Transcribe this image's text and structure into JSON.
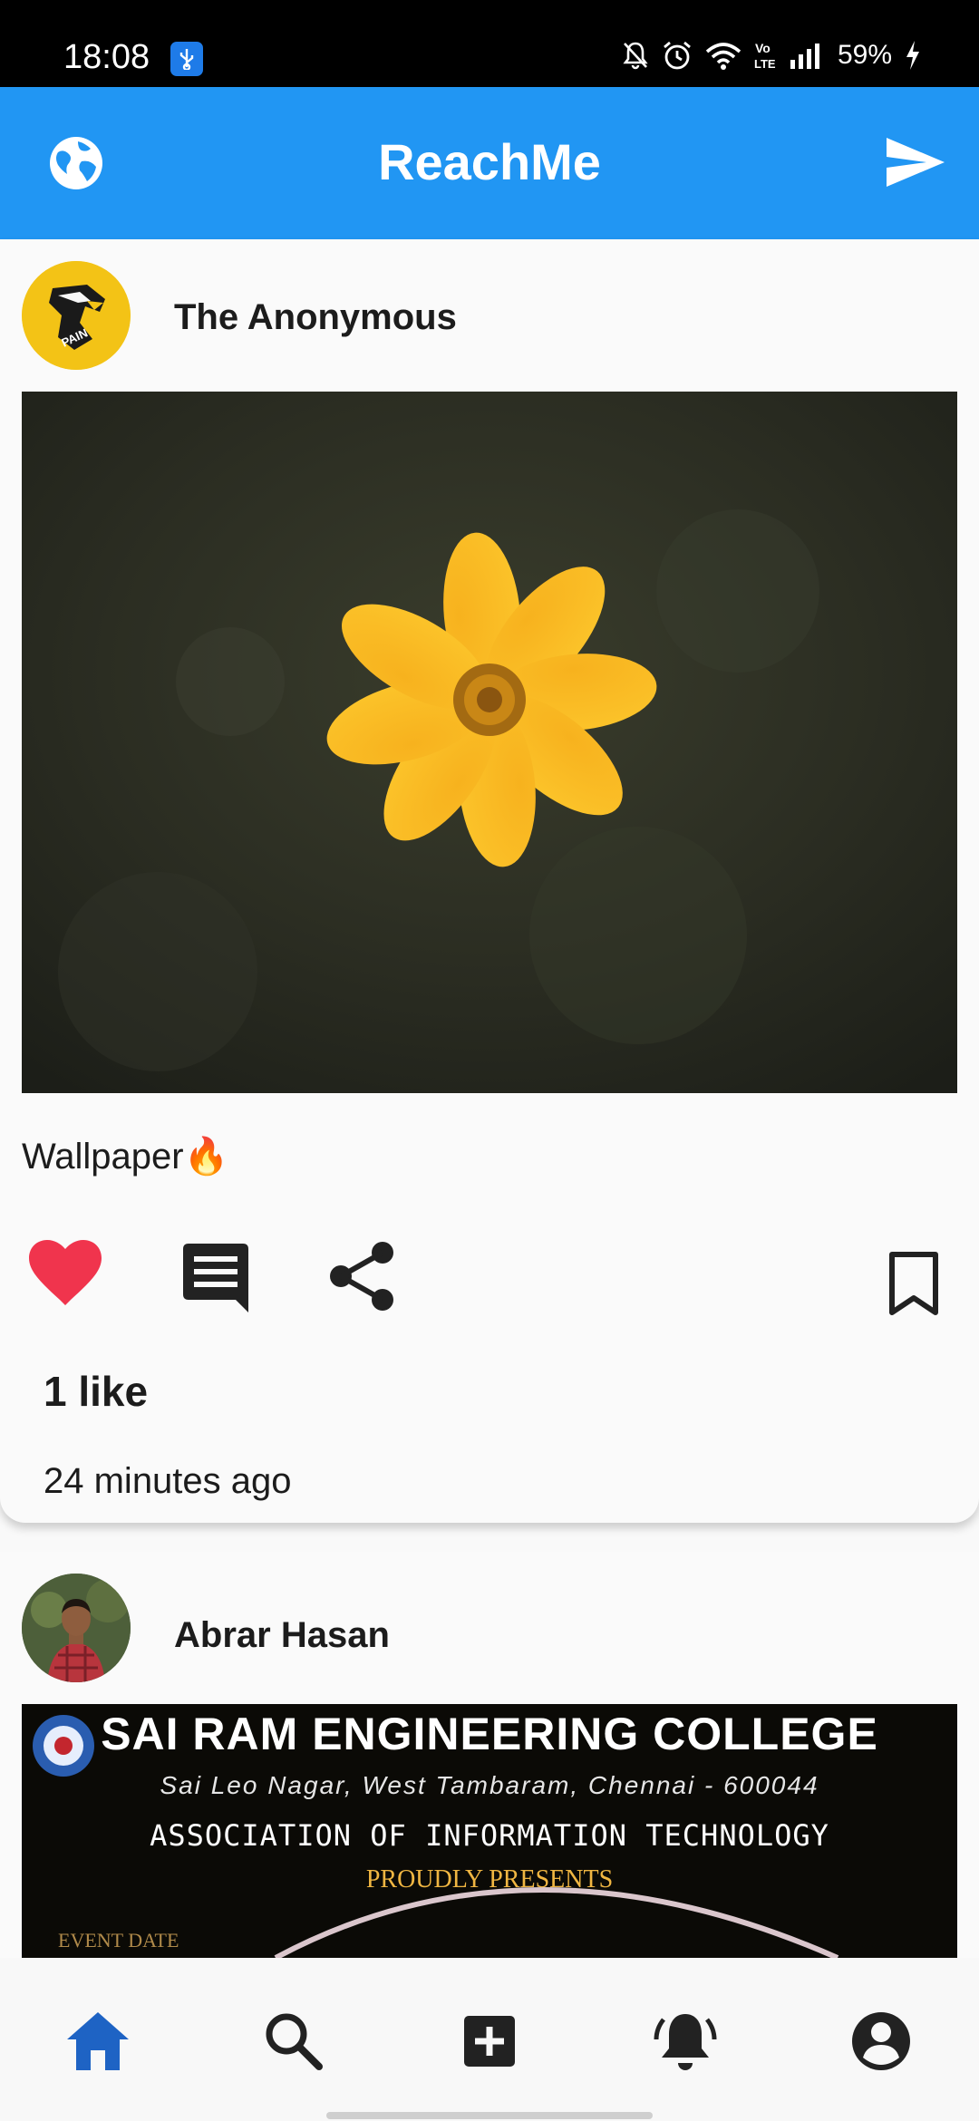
{
  "status_bar": {
    "time": "18:08",
    "battery": "59%",
    "icons": [
      "usb-icon",
      "mute-icon",
      "alarm-icon",
      "wifi-icon",
      "volte-icon",
      "signal-icon",
      "charging-icon"
    ]
  },
  "app_bar": {
    "title": "ReachMe",
    "left_icon": "globe-icon",
    "right_icon": "send-icon",
    "color": "#2196f3"
  },
  "posts": [
    {
      "author": "The Anonymous",
      "avatar_text": "PAIN",
      "caption": "Wallpaper🔥",
      "likes": "1 like",
      "time": "24 minutes ago",
      "liked": true
    },
    {
      "author": "Abrar Hasan",
      "banner": {
        "title": "SAI RAM ENGINEERING COLLEGE",
        "address": "Sai Leo Nagar, West Tambaram, Chennai - 600044",
        "association": "ASSOCIATION OF INFORMATION TECHNOLOGY",
        "presents": "PROUDLY PRESENTS",
        "event_date": "EVENT DATE"
      }
    }
  ],
  "bottom_nav": {
    "items": [
      "home-icon",
      "search-icon",
      "add-post-icon",
      "notifications-icon",
      "profile-icon"
    ],
    "active": "home-icon",
    "active_color": "#1e63c4"
  },
  "colors": {
    "like": "#f0344d",
    "icon": "#222222"
  }
}
